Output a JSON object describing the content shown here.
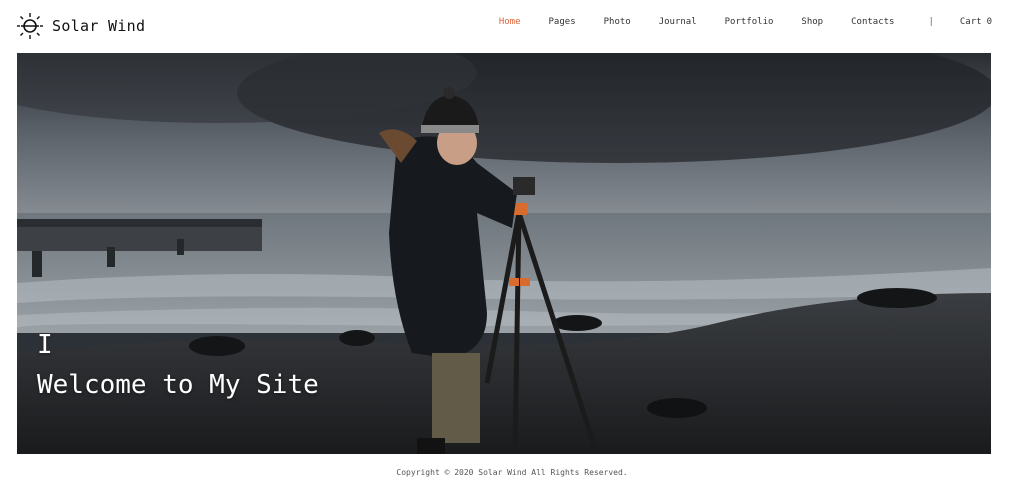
{
  "site": {
    "name": "Solar Wind",
    "logo_icon": "sun-orbit-icon"
  },
  "nav": {
    "items": [
      {
        "label": "Home",
        "active": true
      },
      {
        "label": "Pages",
        "active": false
      },
      {
        "label": "Photo",
        "active": false
      },
      {
        "label": "Journal",
        "active": false
      },
      {
        "label": "Portfolio",
        "active": false
      },
      {
        "label": "Shop",
        "active": false
      },
      {
        "label": "Contacts",
        "active": false
      }
    ],
    "separator": "|",
    "cart_label": "Cart",
    "cart_count": "0",
    "active_color": "#e0643c"
  },
  "hero": {
    "cursor_text": "I",
    "title": "Welcome to My Site",
    "image_description_icon": "photographer-with-tripod-on-rocky-shore-photo"
  },
  "footer": {
    "copyright": "Copyright © 2020 Solar Wind All Rights Reserved."
  }
}
